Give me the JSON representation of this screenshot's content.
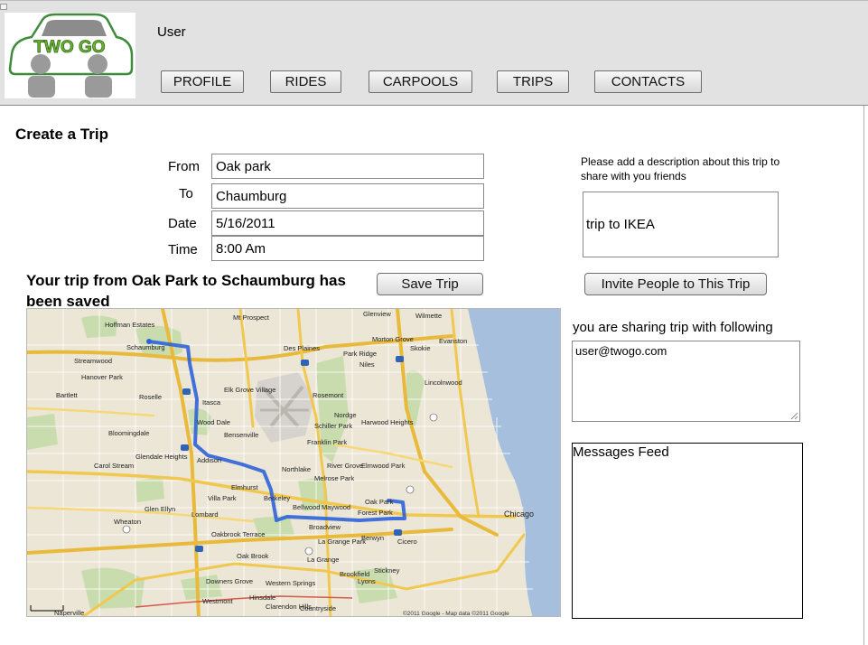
{
  "header": {
    "logo_text": "TWO GO",
    "username": "User",
    "nav": [
      {
        "label": "PROFILE"
      },
      {
        "label": "RIDES"
      },
      {
        "label": "CARPOOLS"
      },
      {
        "label": "TRIPS"
      },
      {
        "label": "CONTACTS"
      }
    ]
  },
  "page": {
    "title": "Create  a Trip"
  },
  "form": {
    "from_label": "From",
    "from_value": "Oak park",
    "to_label": "To",
    "to_value": "Chaumburg",
    "date_label": "Date",
    "date_value": "5/16/2011",
    "time_label": "Time",
    "time_value": "8:00 Am"
  },
  "description": {
    "prompt": "Please add a description about this trip to  share with you friends",
    "value": "trip to IKEA"
  },
  "trip": {
    "saved_message": "Your trip from Oak Park to Schaumburg has been saved",
    "save_button": "Save Trip",
    "invite_button": "Invite People to This Trip"
  },
  "sharing": {
    "label": "you are sharing trip with following",
    "value": "user@twogo.com"
  },
  "feed": {
    "title": "Messages Feed"
  },
  "map": {
    "labels": {
      "schaumburg": "Schaumburg",
      "hoffman_estates": "Hoffman Estates",
      "streamwood": "Streamwood",
      "hanover_park": "Hanover Park",
      "bartlett": "Bartlett",
      "roselle": "Roselle",
      "itasca": "Itasca",
      "elk_grove": "Elk Grove Village",
      "wood_dale": "Wood Dale",
      "bensenville": "Bensenville",
      "des_plaines": "Des Plaines",
      "mt_prospect": "Mt Prospect",
      "park_ridge": "Park Ridge",
      "niles": "Niles",
      "rosemont": "Rosemont",
      "skokie": "Skokie",
      "evanston": "Evanston",
      "glenview": "Glenview",
      "wilmette": "Wilmette",
      "morton_grove": "Morton Grove",
      "lincolnwood": "Lincolnwood",
      "bloomingdale": "Bloomingdale",
      "addison": "Addison",
      "glendale_heights": "Glendale Heights",
      "carol_stream": "Carol Stream",
      "glen_ellyn": "Glen Ellyn",
      "wheaton": "Wheaton",
      "lombard": "Lombard",
      "villa_park": "Villa Park",
      "elmhurst": "Elmhurst",
      "franklin_park": "Franklin Park",
      "northlake": "Northlake",
      "melrose_park": "Melrose Park",
      "river_grove": "River Grove",
      "elmwood_park": "Elmwood Park",
      "berkeley": "Berkeley",
      "bellwood": "Bellwood",
      "maywood": "Maywood",
      "oak_park": "Oak Park",
      "forest_park": "Forest Park",
      "broadview": "Broadview",
      "berwyn": "Berwyn",
      "cicero": "Cicero",
      "chicago": "Chicago",
      "oakbrook_terrace": "Oakbrook Terrace",
      "oak_brook": "Oak Brook",
      "la_grange_park": "La Grange Park",
      "la_grange": "La Grange",
      "brookfield": "Brookfield",
      "lyons": "Lyons",
      "stickney": "Stickney",
      "downers_grove": "Downers Grove",
      "westmont": "Westmont",
      "western_springs": "Western Springs",
      "hinsdale": "Hinsdale",
      "clarendon_hills": "Clarendon Hills",
      "countryside": "Countryside",
      "naperville": "Naperville",
      "nordge": "Nordge",
      "harwood_heights": "Harwood Heights",
      "schiller_park": "Schiller Park",
      "copyright": "©2011 Google - Map data ©2011 Google"
    }
  }
}
